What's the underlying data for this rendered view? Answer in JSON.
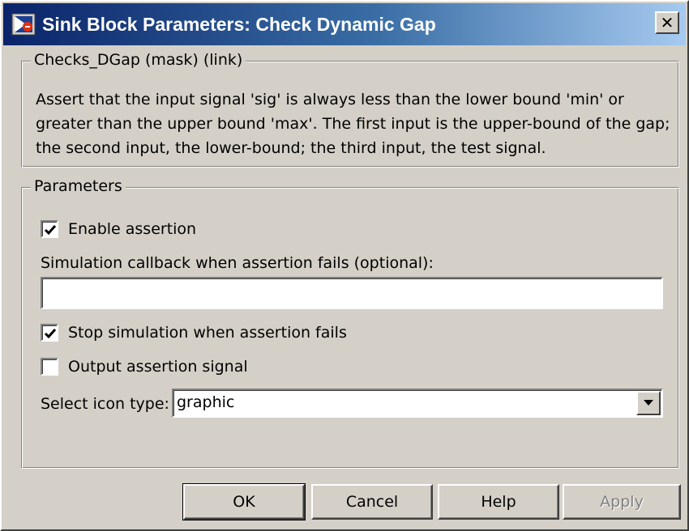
{
  "window": {
    "title": "Sink Block Parameters: Check  Dynamic Gap",
    "close_glyph": "✕",
    "icon": "simulink-block-icon"
  },
  "description_group": {
    "legend": "Checks_DGap (mask) (link)",
    "text": "Assert that the input signal 'sig' is always less than the lower bound 'min' or greater than the upper bound 'max'.  The first input is the upper-bound of the gap; the second input, the lower-bound; the third input, the test signal."
  },
  "parameters_group": {
    "legend": "Parameters",
    "enable_assertion": {
      "label": "Enable assertion",
      "checked": true
    },
    "callback": {
      "label": "Simulation callback when assertion fails (optional):",
      "value": ""
    },
    "stop_simulation": {
      "label": "Stop simulation when assertion fails",
      "checked": true
    },
    "output_signal": {
      "label": "Output assertion signal",
      "checked": false
    },
    "icon_type": {
      "label": "Select icon type:",
      "value": "graphic"
    }
  },
  "buttons": {
    "ok": "OK",
    "cancel": "Cancel",
    "help": "Help",
    "apply": "Apply"
  },
  "colors": {
    "title_bar_start": "#0a246a",
    "title_bar_end": "#a6caf0",
    "face": "#d4d0c8"
  }
}
